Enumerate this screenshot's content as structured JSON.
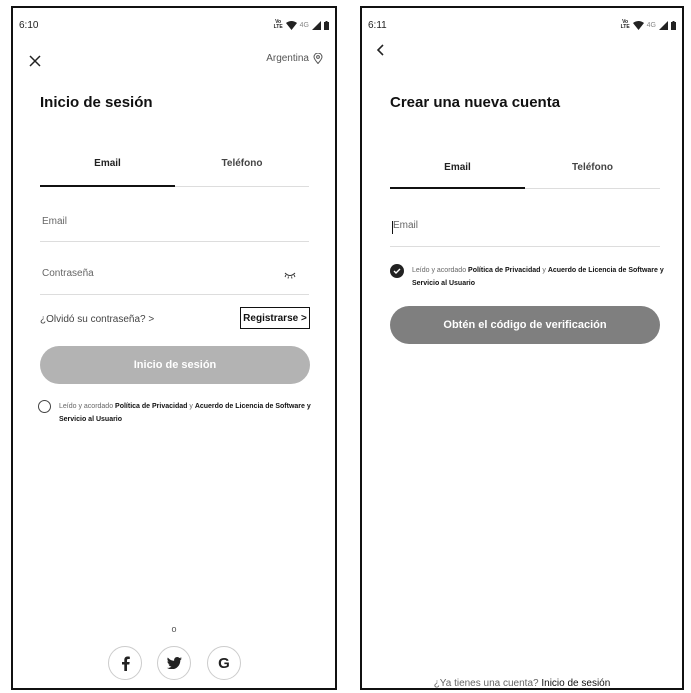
{
  "left": {
    "status": {
      "time": "6:10",
      "volte": "VoLTE",
      "network": "4G"
    },
    "region": "Argentina",
    "title": "Inicio de sesión",
    "tabs": [
      "Email",
      "Teléfono"
    ],
    "email_placeholder": "Email",
    "password_placeholder": "Contraseña",
    "forgot": "¿Olvidó su contraseña? >",
    "register": "Registrarse >",
    "login_button": "Inicio de sesión",
    "agreement": {
      "prefix": "Leído y acordado ",
      "privacy": "Política de Privacidad",
      "and": " y ",
      "license": "Acuerdo de Licencia de Software y Servicio al Usuario"
    },
    "or": "o",
    "social": {
      "facebook": "f",
      "twitter": "t",
      "google": "G"
    },
    "colors": {
      "button": "#b3b3b3"
    }
  },
  "right": {
    "status": {
      "time": "6:11",
      "volte": "VoLTE",
      "network": "4G"
    },
    "title": "Crear una nueva cuenta",
    "tabs": [
      "Email",
      "Teléfono"
    ],
    "email_placeholder": "Email",
    "agreement": {
      "prefix": "Leído y acordado ",
      "privacy": "Política de Privacidad",
      "and": " y ",
      "license": "Acuerdo de Licencia de Software y Servicio al Usuario"
    },
    "verify_button": "Obtén el código de verificación",
    "footer": {
      "question": "¿Ya tienes una cuenta? ",
      "link": "Inicio de sesión"
    },
    "colors": {
      "button": "#7f7f7f"
    }
  }
}
